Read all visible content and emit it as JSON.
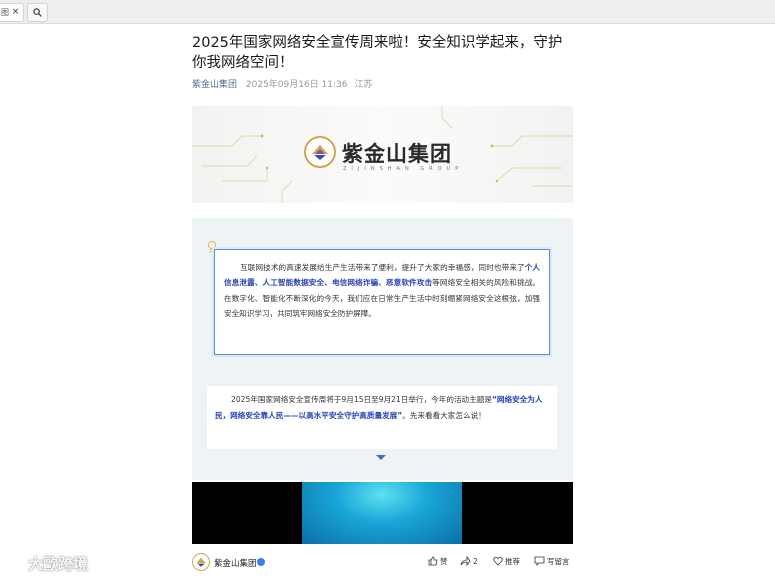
{
  "browser": {
    "tab_label": "图",
    "tab_close": "×"
  },
  "article": {
    "title": "2025年国家网络安全宣传周来啦！安全知识学起来，守护你我网络空间！",
    "account": "紫金山集团",
    "date": "2025年09月16日 11:36",
    "location": "江苏"
  },
  "banner": {
    "logo_cn": "紫金山集团",
    "logo_en": "ZIJINSHAN GROUP"
  },
  "box1": {
    "seg1": "互联网技术的高速发展给生产生活带来了便利，提升了大家的幸福感，同时也带来了",
    "highlight": "个人信息泄露、人工智能数据安全、电信网络诈骗、恶意软件攻击",
    "seg2": "等网络安全相关的风险和挑战。在数字化、智能化不断深化的今天，我们应在日常生产生活中时刻绷紧网络安全这根弦，加强安全知识学习，共同筑牢网络安全防护屏障。"
  },
  "box2": {
    "seg1": "2025年国家网络安全宣传周将于9月15日至9月21日举行，今年的活动主题是",
    "highlight": "“网络安全为人民，网络安全靠人民——以高水平安全守护高质量发展”",
    "seg2": "。先来看看大家怎么说！"
  },
  "footer": {
    "account": "紫金山集团",
    "like": "赞",
    "share_count": "2",
    "recommend": "推荐",
    "comment": "写留言"
  },
  "watermark": {
    "text": "大歐跨境"
  },
  "colors": {
    "accent": "#2a45b8",
    "link": "#576b95",
    "gold": "#d2a64a"
  }
}
